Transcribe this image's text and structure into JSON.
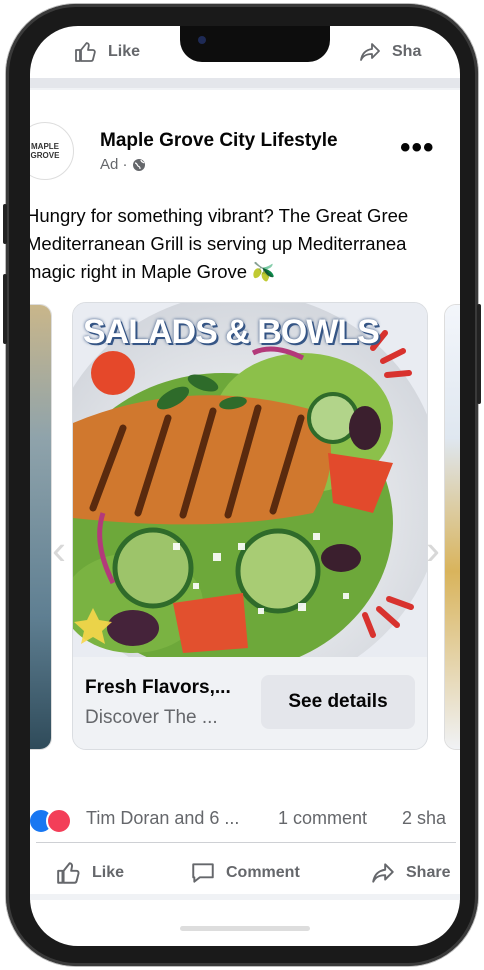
{
  "top_bar": {
    "like_label": "Like",
    "share_label": "Sha"
  },
  "post": {
    "avatar_text": "MAPLE GROVE",
    "page_name": "Maple Grove City Lifestyle",
    "sponsored_label": "Ad ·",
    "more_label": "•••",
    "caption_lines": [
      "Hungry for something vibrant? The Great Gree",
      "Mediterranean Grill is serving up Mediterranea",
      "magic right in Maple Grove 🫒"
    ]
  },
  "carousel": {
    "card": {
      "banner": "SALADS & BOWLS",
      "title": "Fresh Flavors,...",
      "description": "Discover The ...",
      "cta": "See details"
    },
    "prev_label": "‹",
    "next_label": "›"
  },
  "engagement": {
    "reactions_text": "Tim Doran and 6 ...",
    "comments_text": "1 comment",
    "shares_text": "2 sha"
  },
  "actions": {
    "like": "Like",
    "comment": "Comment",
    "share": "Share"
  },
  "colors": {
    "brand_blue": "#1877f2",
    "love_red": "#f33e58",
    "text": "#050505",
    "muted": "#65676b"
  }
}
